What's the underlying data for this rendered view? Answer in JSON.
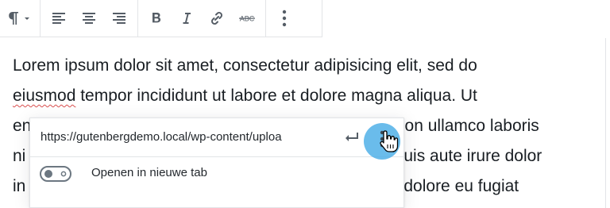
{
  "toolbar": {
    "items": [
      {
        "name": "paragraph-icon",
        "label": "Paragraph"
      },
      {
        "name": "align-left-icon",
        "label": "Align left"
      },
      {
        "name": "align-center-icon",
        "label": "Align center"
      },
      {
        "name": "align-right-icon",
        "label": "Align right"
      },
      {
        "name": "bold-icon",
        "label": "Bold"
      },
      {
        "name": "italic-icon",
        "label": "Italic"
      },
      {
        "name": "link-icon",
        "label": "Link"
      },
      {
        "name": "strikethrough-icon",
        "label": "Strikethrough"
      },
      {
        "name": "more-options-icon",
        "label": "More options"
      }
    ]
  },
  "content": {
    "line1": "Lorem ipsum dolor sit amet, consectetur adipisicing elit, sed do",
    "line2_misspelled": "eiusmod",
    "line2_rest": " tempor incididunt ut labore et dolore magna aliqua. Ut",
    "line3_start": "en",
    "line3_end": "ation ullamco laboris",
    "line4_start": "ni",
    "line4_end": "uis aute irure dolor",
    "line5_start": "in",
    "line5_end": "dolore eu fugiat"
  },
  "link_popover": {
    "url": "https://gutenbergdemo.local/wp-content/uploa",
    "toggle_label": "Openen in nieuwe tab",
    "toggle_on": false
  },
  "colors": {
    "icon": "#555d66",
    "border": "#e2e4e7",
    "highlight": "#50b0e8",
    "spellcheck": "#d94f4f"
  }
}
